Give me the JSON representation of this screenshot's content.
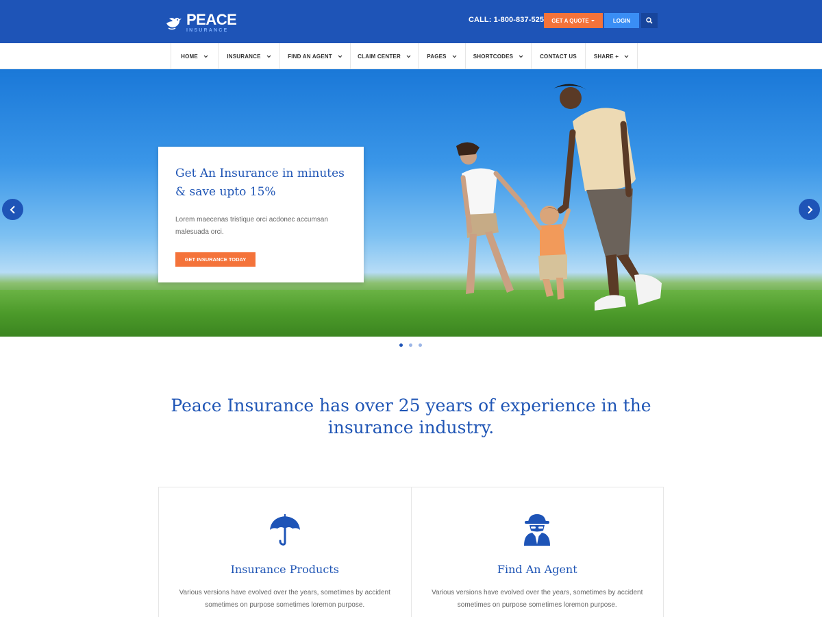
{
  "brand": {
    "name": "PEACE",
    "tagline": "INSURANCE"
  },
  "header": {
    "call": "CALL: 1-800-837-5254",
    "quote_label": "GET A QUOTE",
    "login_label": "LOGIN",
    "search_icon": "search-icon"
  },
  "nav": {
    "items": [
      {
        "label": "HOME",
        "dropdown": true
      },
      {
        "label": "INSURANCE",
        "dropdown": true
      },
      {
        "label": "FIND AN AGENT",
        "dropdown": true
      },
      {
        "label": "CLAIM CENTER",
        "dropdown": true
      },
      {
        "label": "PAGES",
        "dropdown": true
      },
      {
        "label": "SHORTCODES",
        "dropdown": true
      },
      {
        "label": "CONTACT US",
        "dropdown": false
      },
      {
        "label": "SHARE +",
        "dropdown": true
      }
    ]
  },
  "hero": {
    "title": "Get An Insurance in minutes & save upto 15%",
    "text": "Lorem maecenas tristique orci acdonec accumsan malesuada orci.",
    "button": "GET INSURANCE TODAY",
    "slides": 3,
    "active_slide": 1
  },
  "intro": "Peace Insurance has over 25 years of experience in the insurance industry.",
  "features": [
    {
      "icon": "umbrella-icon",
      "title": "Insurance Products",
      "text": "Various versions have evolved over the years, sometimes by accident sometimes on purpose sometimes loremon purpose."
    },
    {
      "icon": "agent-icon",
      "title": "Find An Agent",
      "text": "Various versions have evolved over the years, sometimes by accident sometimes on purpose sometimes loremon purpose."
    }
  ],
  "colors": {
    "primary": "#1e54b7",
    "accent": "#f4733a",
    "login": "#3a8ef5"
  }
}
